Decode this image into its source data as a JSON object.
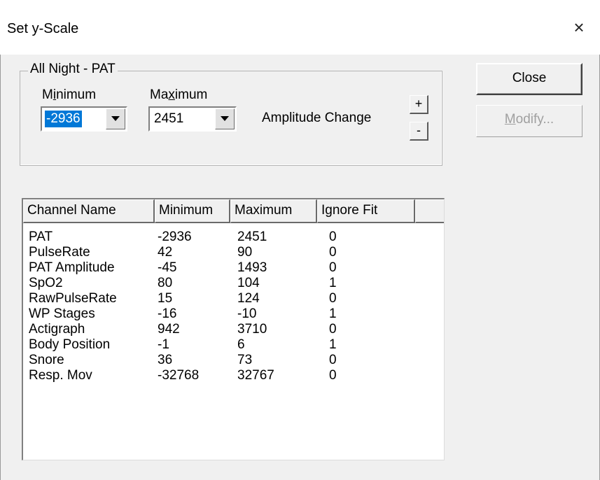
{
  "window": {
    "title": "Set y-Scale",
    "close_symbol": "×"
  },
  "group": {
    "title": "All Night - PAT",
    "minimum_label_pre": "M",
    "minimum_label_u": "i",
    "minimum_label_post": "nimum",
    "maximum_label_pre": "Ma",
    "maximum_label_u": "x",
    "maximum_label_post": "imum",
    "minimum_value": "-2936",
    "maximum_value": "2451",
    "amplitude_label": "Amplitude Change",
    "plus_label": "+",
    "minus_label": "-"
  },
  "buttons": {
    "close_label": "Close",
    "modify_u": "M",
    "modify_rest": "odify..."
  },
  "table": {
    "columns": [
      "Channel Name",
      "Minimum",
      "Maximum",
      "Ignore Fit"
    ],
    "rows": [
      [
        "PAT",
        "-2936",
        "2451",
        "0"
      ],
      [
        "PulseRate",
        "42",
        "90",
        "0"
      ],
      [
        "PAT Amplitude",
        "-45",
        "1493",
        "0"
      ],
      [
        "SpO2",
        "80",
        "104",
        "1"
      ],
      [
        "RawPulseRate",
        "15",
        "124",
        "0"
      ],
      [
        "WP Stages",
        "-16",
        "-10",
        "1"
      ],
      [
        "Actigraph",
        "942",
        "3710",
        "0"
      ],
      [
        "Body Position",
        "-1",
        "6",
        "1"
      ],
      [
        "Snore",
        "36",
        "73",
        "0"
      ],
      [
        "Resp. Mov",
        "-32768",
        "32767",
        "0"
      ]
    ]
  }
}
